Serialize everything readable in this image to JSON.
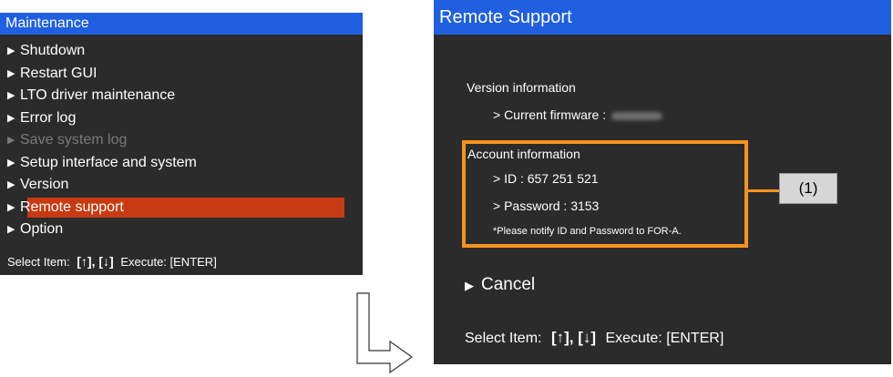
{
  "maintenance": {
    "title": "Maintenance",
    "items": [
      {
        "label": "Shutdown"
      },
      {
        "label": "Restart GUI"
      },
      {
        "label": "LTO driver maintenance"
      },
      {
        "label": "Error log"
      },
      {
        "label": "Save system log"
      },
      {
        "label": "Setup interface and system"
      },
      {
        "label": "Version"
      },
      {
        "label": "Remote support"
      },
      {
        "label": "Option"
      }
    ],
    "footer": {
      "select_label": "Select Item:",
      "keys": "[↑], [↓]",
      "execute_label": "Execute: [ENTER]"
    }
  },
  "remote_support": {
    "title": "Remote Support",
    "version_heading": "Version information",
    "current_firmware_label": "> Current firmware :",
    "account_heading": "Account information",
    "id_line": "> ID : 657 251 521",
    "password_line": "> Password : 3153",
    "note": "*Please notify ID and Password to FOR-A.",
    "cancel_label": "Cancel",
    "footer": {
      "select_label": "Select Item:",
      "keys": "[↑], [↓]",
      "execute_label": "Execute: [ENTER]"
    }
  },
  "callout_label": "(1)",
  "colors": {
    "title_bar": "#1f5fe0",
    "panel_bg": "#2b2b2b",
    "selection": "#c73a12",
    "highlight_box": "#f7931e"
  }
}
